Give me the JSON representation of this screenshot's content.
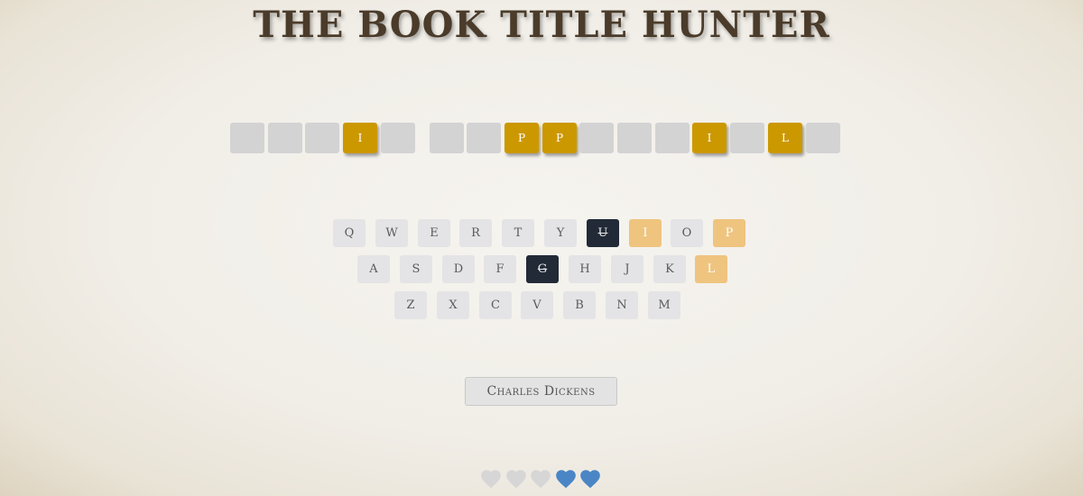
{
  "title": "THE BOOK TITLE HUNTER",
  "board": [
    [
      "",
      "",
      "",
      "I",
      ""
    ],
    [
      "",
      "",
      "P",
      "P",
      "",
      "",
      "",
      "I",
      "",
      "L",
      ""
    ]
  ],
  "keyboard": {
    "rows": [
      [
        {
          "letter": "Q",
          "state": "unused"
        },
        {
          "letter": "W",
          "state": "unused"
        },
        {
          "letter": "E",
          "state": "unused"
        },
        {
          "letter": "R",
          "state": "unused"
        },
        {
          "letter": "T",
          "state": "unused"
        },
        {
          "letter": "Y",
          "state": "unused"
        },
        {
          "letter": "U",
          "state": "wrong"
        },
        {
          "letter": "I",
          "state": "found"
        },
        {
          "letter": "O",
          "state": "unused"
        },
        {
          "letter": "P",
          "state": "found"
        }
      ],
      [
        {
          "letter": "A",
          "state": "unused"
        },
        {
          "letter": "S",
          "state": "unused"
        },
        {
          "letter": "D",
          "state": "unused"
        },
        {
          "letter": "F",
          "state": "unused"
        },
        {
          "letter": "G",
          "state": "wrong"
        },
        {
          "letter": "H",
          "state": "unused"
        },
        {
          "letter": "J",
          "state": "unused"
        },
        {
          "letter": "K",
          "state": "unused"
        },
        {
          "letter": "L",
          "state": "found"
        }
      ],
      [
        {
          "letter": "Z",
          "state": "unused"
        },
        {
          "letter": "X",
          "state": "unused"
        },
        {
          "letter": "C",
          "state": "unused"
        },
        {
          "letter": "V",
          "state": "unused"
        },
        {
          "letter": "B",
          "state": "unused"
        },
        {
          "letter": "N",
          "state": "unused"
        },
        {
          "letter": "M",
          "state": "unused"
        }
      ]
    ]
  },
  "hint": {
    "label": "Charles Dickens"
  },
  "lives": {
    "total": 5,
    "remaining": 2,
    "colors": {
      "lost": "#d6d6d6",
      "remaining": "#4a86c5"
    }
  },
  "colors": {
    "revealed_tile": "#cc9800",
    "wrong_key": "#222a38",
    "found_key": "#eec47f"
  }
}
